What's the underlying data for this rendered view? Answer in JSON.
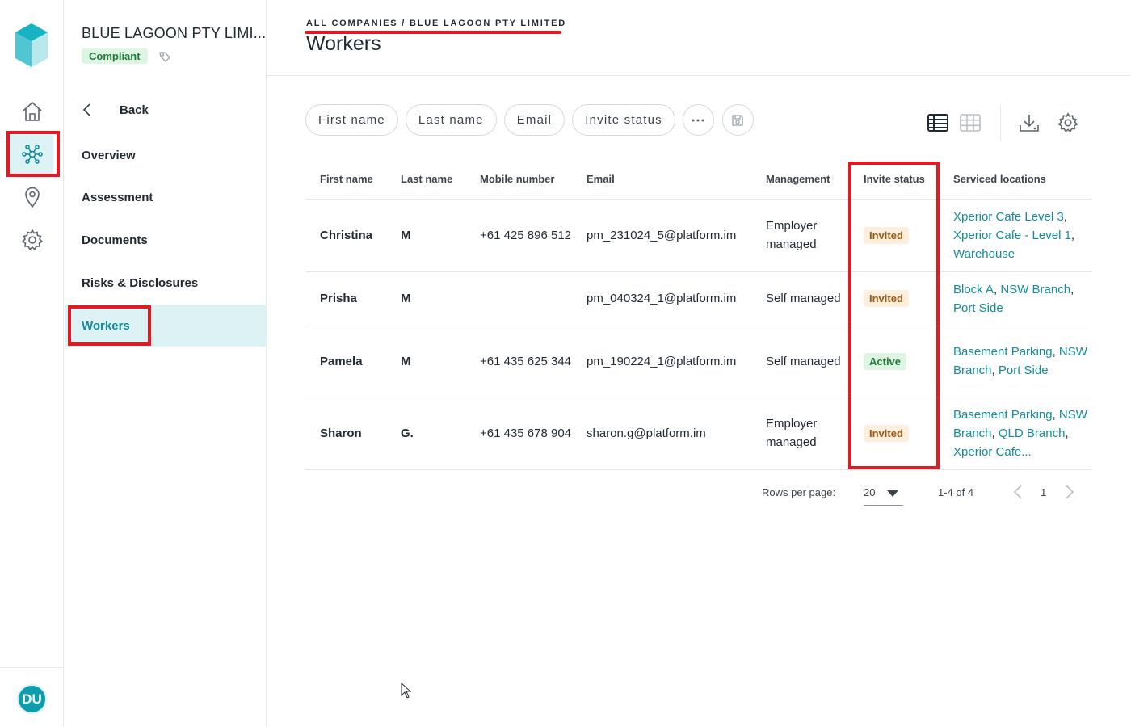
{
  "rail": {
    "avatar_initials": "DU",
    "icons": [
      "home-icon",
      "network-icon",
      "location-pin-icon",
      "gear-icon"
    ]
  },
  "company": {
    "name": "BLUE LAGOON PTY LIMI...",
    "status": "Compliant"
  },
  "subnav": {
    "back_label": "Back",
    "items": [
      {
        "label": "Overview"
      },
      {
        "label": "Assessment"
      },
      {
        "label": "Documents"
      },
      {
        "label": "Risks & Disclosures"
      },
      {
        "label": "Workers"
      }
    ],
    "active": "Workers"
  },
  "header": {
    "breadcrumb": "ALL COMPANIES / BLUE LAGOON PTY LIMITED",
    "title": "Workers"
  },
  "filters": [
    "First name",
    "Last name",
    "Email",
    "Invite status"
  ],
  "table": {
    "columns": [
      "First name",
      "Last name",
      "Mobile number",
      "Email",
      "Management",
      "Invite status",
      "Serviced locations"
    ],
    "rows": [
      {
        "first": "Christina",
        "last": "M",
        "mobile": "+61 425 896 512",
        "email": "pm_231024_5@platform.im",
        "management": "Employer managed",
        "status": "Invited",
        "locations": [
          "Xperior Cafe Level 3",
          "Xperior Cafe - Level 1",
          "Warehouse"
        ]
      },
      {
        "first": "Prisha",
        "last": "M",
        "mobile": "",
        "email": "pm_040324_1@platform.im",
        "management": "Self managed",
        "status": "Invited",
        "locations": [
          "Block A",
          "NSW Branch",
          "Port Side"
        ]
      },
      {
        "first": "Pamela",
        "last": "M",
        "mobile": "+61 435 625 344",
        "email": "pm_190224_1@platform.im",
        "management": "Self managed",
        "status": "Active",
        "locations": [
          "Basement Parking",
          "NSW Branch",
          "Port Side"
        ]
      },
      {
        "first": "Sharon",
        "last": "G.",
        "mobile": "+61 435 678 904",
        "email": "sharon.g@platform.im",
        "management": "Employer managed",
        "status": "Invited",
        "locations": [
          "Basement Parking",
          "NSW Branch",
          "QLD Branch",
          "Xperior Cafe..."
        ]
      }
    ]
  },
  "pagination": {
    "rows_per_page_label": "Rows per page:",
    "rows_per_page": "20",
    "range": "1-4 of 4",
    "page": "1"
  },
  "colors": {
    "accent": "#128b9a",
    "annotation": "#e01b24"
  }
}
